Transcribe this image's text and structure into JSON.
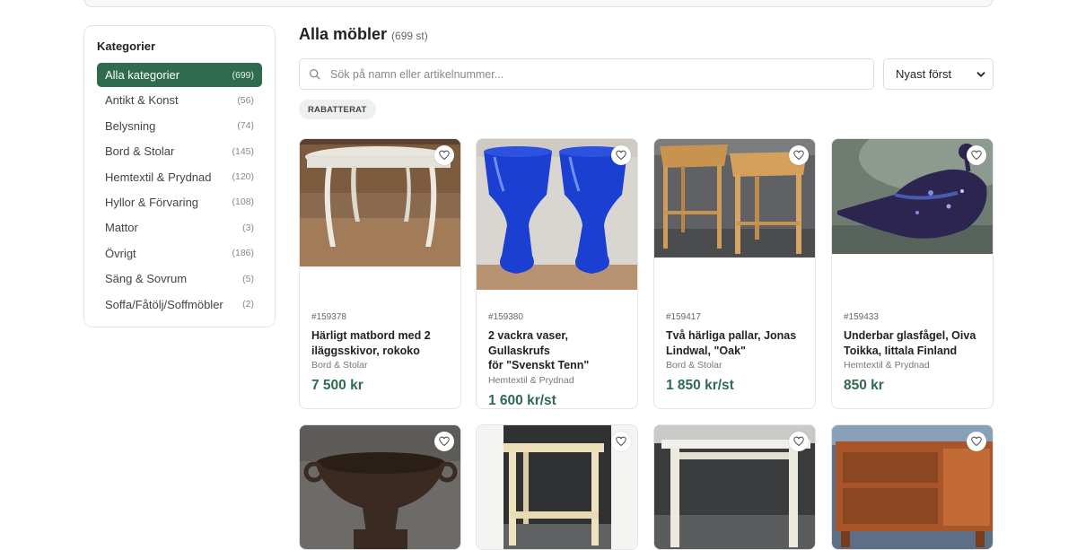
{
  "sidebar": {
    "heading": "Kategorier",
    "items": [
      {
        "label": "Alla kategorier",
        "count": "(699)",
        "active": true
      },
      {
        "label": "Antikt & Konst",
        "count": "(56)"
      },
      {
        "label": "Belysning",
        "count": "(74)"
      },
      {
        "label": "Bord & Stolar",
        "count": "(145)"
      },
      {
        "label": "Hemtextil & Prydnad",
        "count": "(120)"
      },
      {
        "label": "Hyllor & Förvaring",
        "count": "(108)"
      },
      {
        "label": "Mattor",
        "count": "(3)"
      },
      {
        "label": "Övrigt",
        "count": "(186)"
      },
      {
        "label": "Säng & Sovrum",
        "count": "(5)"
      },
      {
        "label": "Soffa/Fåtölj/Soffmöbler",
        "count": "(2)"
      }
    ]
  },
  "main": {
    "title": "Alla möbler",
    "subtitle": "(699 st)",
    "search_placeholder": "Sök på namn eller artikelnummer...",
    "sort_value": "Nyast först",
    "chip_label": "RABATTERAT"
  },
  "products": [
    {
      "art": "#159378",
      "name1": "Härligt matbord med 2",
      "name2": "iläggsskivor, rokoko",
      "category": "Bord & Stolar",
      "price": "7 500 kr"
    },
    {
      "art": "#159380",
      "name1": "2 vackra vaser, Gullaskrufs",
      "name2": "för \"Svenskt Tenn\"",
      "category": "Hemtextil & Prydnad",
      "price": "1 600 kr/st"
    },
    {
      "art": "#159417",
      "name1": "Två härliga pallar, Jonas",
      "name2": "Lindwal, \"Oak\"",
      "category": "Bord & Stolar",
      "price": "1 850 kr/st"
    },
    {
      "art": "#159433",
      "name1": "Underbar glasfågel, Oiva",
      "name2": "Toikka, Iittala Finland",
      "category": "Hemtextil & Prydnad",
      "price": "850 kr"
    }
  ],
  "icons": {
    "search": "search-icon",
    "heart": "heart-icon",
    "chevron": "chevron-down-icon"
  },
  "colors": {
    "accent": "#2e6b4f"
  }
}
